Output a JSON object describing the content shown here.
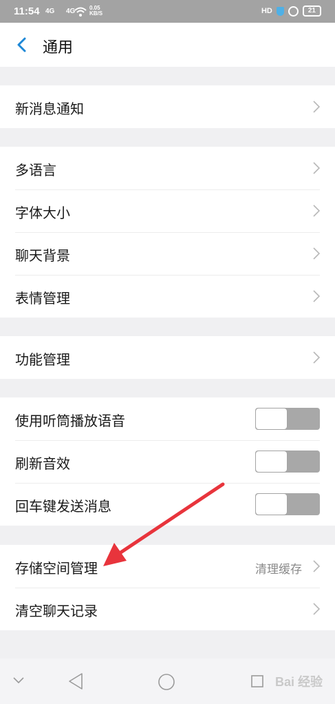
{
  "status_bar": {
    "time": "11:54",
    "signal_1": "4G",
    "signal_2": "4G",
    "net_speed": "0.05",
    "net_unit": "KB/S",
    "hd_label": "HD",
    "battery": "21"
  },
  "header": {
    "title": "通用",
    "back_icon": "chevron-left-icon"
  },
  "sections": {
    "notifications": {
      "label": "新消息通知"
    },
    "display": {
      "items": [
        {
          "label": "多语言"
        },
        {
          "label": "字体大小"
        },
        {
          "label": "聊天背景"
        },
        {
          "label": "表情管理"
        }
      ]
    },
    "features": {
      "label": "功能管理"
    },
    "toggles": {
      "items": [
        {
          "label": "使用听筒播放语音",
          "state": "off"
        },
        {
          "label": "刷新音效",
          "state": "off"
        },
        {
          "label": "回车键发送消息",
          "state": "off"
        }
      ]
    },
    "storage": {
      "items": [
        {
          "label": "存储空间管理",
          "value": "清理缓存"
        },
        {
          "label": "清空聊天记录"
        }
      ]
    }
  },
  "nav_bar": {
    "icons": [
      "chevron-down-icon",
      "back-triangle-icon",
      "home-circle-icon",
      "recents-square-icon"
    ],
    "watermark": "Bai 经验"
  },
  "colors": {
    "accent": "#1e88d6",
    "toggle_track": "#a8a8a8",
    "annotation_arrow": "#e8343c",
    "background": "#f0f0f2"
  }
}
